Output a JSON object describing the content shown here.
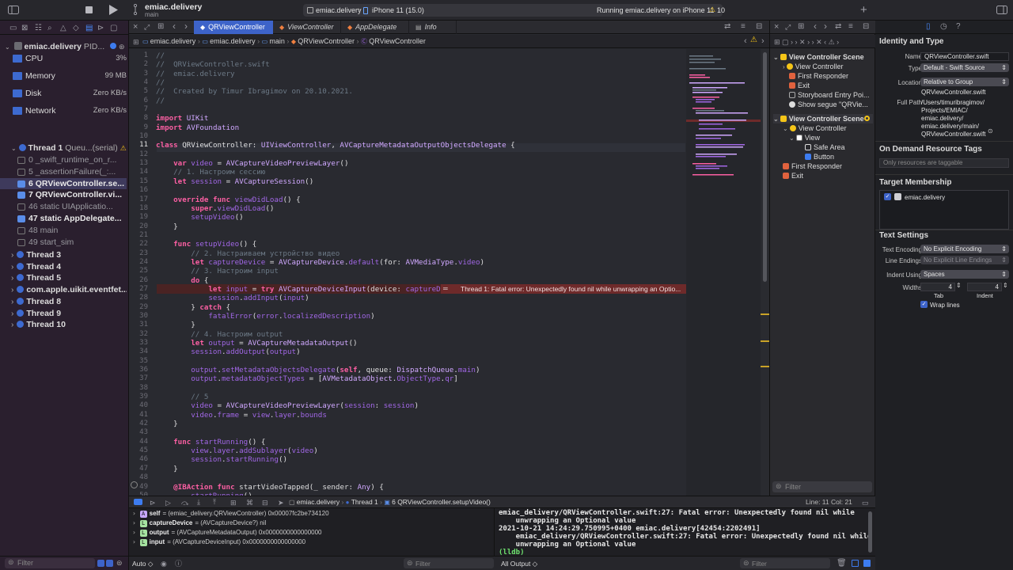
{
  "window": {
    "project": "emiac.delivery",
    "branch": "main",
    "scheme": "emiac.delivery",
    "device": "iPhone 11 (15.0)",
    "status": "Running emiac.delivery on iPhone 11",
    "warnings": "10"
  },
  "navigator": {
    "process": "emiac.delivery",
    "pid": "PID...",
    "gauges": [
      {
        "name": "CPU",
        "value": "3%"
      },
      {
        "name": "Memory",
        "value": "99 MB"
      },
      {
        "name": "Disk",
        "value": "Zero KB/s"
      },
      {
        "name": "Network",
        "value": "Zero KB/s"
      }
    ],
    "thread1": "Thread 1",
    "thread1_queue": "Queu...(serial)",
    "frames": [
      {
        "label": "0 _swift_runtime_on_r...",
        "dim": true
      },
      {
        "label": "5 _assertionFailure(_:...",
        "dim": true
      },
      {
        "label": "6 QRViewController.se...",
        "selected": true
      },
      {
        "label": "7 QRViewController.vi...",
        "dim": false
      },
      {
        "label": "46 static UIApplicatio...",
        "dim": true
      },
      {
        "label": "47 static AppDelegate...",
        "dim": false
      },
      {
        "label": "48 main",
        "dim": true
      },
      {
        "label": "49 start_sim",
        "dim": true
      }
    ],
    "threads": [
      "Thread 3",
      "Thread 4",
      "Thread 5",
      "com.apple.uikit.eventfet...",
      "Thread 8",
      "Thread 9",
      "Thread 10"
    ],
    "filter_placeholder": "Filter"
  },
  "tabs": [
    {
      "label": "QRViewController",
      "active": true
    },
    {
      "label": "ViewController",
      "active": false
    },
    {
      "label": "AppDelegate",
      "active": false
    },
    {
      "label": "Info",
      "active": false
    }
  ],
  "breadcrumb": [
    "emiac.delivery",
    "emiac.delivery",
    "main",
    "QRViewController",
    "QRViewController"
  ],
  "code": [
    "//",
    "//  QRViewController.swift",
    "//  emiac.delivery",
    "//",
    "//  Created by Timur Ibragimov on 20.10.2021.",
    "//",
    "",
    "import UIKit",
    "import AVFoundation",
    "",
    "class QRViewController: UIViewController, AVCaptureMetadataOutputObjectsDelegate {",
    "",
    "    var video = AVCaptureVideoPreviewLayer()",
    "    // 1. Настроим сессию",
    "    let session = AVCaptureSession()",
    "",
    "    override func viewDidLoad() {",
    "        super.viewDidLoad()",
    "        setupVideo()",
    "    }",
    "",
    "    func setupVideo() {",
    "        // 2. Настраиваем устройство видео",
    "        let captureDevice = AVCaptureDevice.default(for: AVMediaType.video)",
    "        // 3. Настроим input",
    "        do {",
    "            let input = try AVCaptureDeviceInput(device: captureDevice!)",
    "            session.addInput(input)",
    "        } catch {",
    "            fatalError(error.localizedDescription)",
    "        }",
    "        // 4. Настроим output",
    "        let output = AVCaptureMetadataOutput()",
    "        session.addOutput(output)",
    "",
    "        output.setMetadataObjectsDelegate(self, queue: DispatchQueue.main)",
    "        output.metadataObjectTypes = [AVMetadataObject.ObjectType.qr]",
    "",
    "        // 5",
    "        video = AVCaptureVideoPreviewLayer(session: session)",
    "        video.frame = view.layer.bounds",
    "    }",
    "",
    "    func startRunning() {",
    "        view.layer.addSublayer(video)",
    "        session.startRunning()",
    "    }",
    "",
    "    @IBAction func startVideoTapped(_ sender: Any) {",
    "        startRunning()"
  ],
  "error_banner": "Thread 1: Fatal error: Unexpectedly found nil while unwrapping an Optio...",
  "storyboard": {
    "scene1": "View Controller Scene",
    "scene1_items": [
      "View Controller",
      "First Responder",
      "Exit",
      "Storyboard Entry Poi...",
      "Show segue \"QRVie..."
    ],
    "scene2": "View Controller Scene",
    "scene2_items": [
      "View Controller",
      "View",
      "Safe Area",
      "Button",
      "First Responder",
      "Exit"
    ],
    "filter_placeholder": "Filter"
  },
  "inspector": {
    "identity_title": "Identity and Type",
    "name_label": "Name",
    "name_value": "QRViewController.swift",
    "type_label": "Type",
    "type_value": "Default - Swift Source",
    "location_label": "Location",
    "location_value": "Relative to Group",
    "location_file": "QRViewController.swift",
    "fullpath_label": "Full Path",
    "fullpath_lines": [
      "/Users/timuribragimov/",
      "Projects/EMIAC/",
      "emiac.delivery/",
      "emiac.delivery/main/",
      "QRViewController.swift"
    ],
    "odr_title": "On Demand Resource Tags",
    "odr_placeholder": "Only resources are taggable",
    "target_title": "Target Membership",
    "target_value": "emiac.delivery",
    "text_title": "Text Settings",
    "encoding_label": "Text Encoding",
    "encoding_value": "No Explicit Encoding",
    "lineend_label": "Line Endings",
    "lineend_value": "No Explicit Line Endings",
    "indent_label": "Indent Using",
    "indent_value": "Spaces",
    "widths_label": "Widths",
    "tab_value": "4",
    "indent_width_value": "4",
    "tab_label": "Tab",
    "indent_sub_label": "Indent",
    "wrap_label": "Wrap lines"
  },
  "debugbar": {
    "crumbs": [
      "emiac.delivery",
      "Thread 1",
      "6 QRViewController.setupVideo()"
    ],
    "position": "Line: 11  Col: 21"
  },
  "variables": [
    {
      "badge": "A",
      "name": "self",
      "value": "= (emiac_delivery.QRViewController) 0x00007fc2be734120"
    },
    {
      "badge": "L",
      "name": "captureDevice",
      "value": "= (AVCaptureDevice?) nil"
    },
    {
      "badge": "L",
      "name": "output",
      "value": "= (AVCaptureMetadataOutput) 0x0000000000000000"
    },
    {
      "badge": "L",
      "name": "input",
      "value": "= (AVCaptureDeviceInput) 0x0000000000000000"
    }
  ],
  "console_lines": [
    "emiac_delivery/QRViewController.swift:27: Fatal error: Unexpectedly found nil while",
    "    unwrapping an Optional value",
    "2021-10-21 14:24:29.750995+0400 emiac.delivery[42454:2202491]",
    "    emiac_delivery/QRViewController.swift:27: Fatal error: Unexpectedly found nil while",
    "    unwrapping an Optional value",
    "(lldb)"
  ],
  "bottom": {
    "auto": "Auto ◇",
    "filter_placeholder": "Filter",
    "all_output": "All Output ◇",
    "console_filter_placeholder": "Filter"
  },
  "colors": {
    "accent": "#3d63c9",
    "error": "#c43a3a",
    "warning": "#f5c518",
    "navbg": "#2a1f2e"
  }
}
